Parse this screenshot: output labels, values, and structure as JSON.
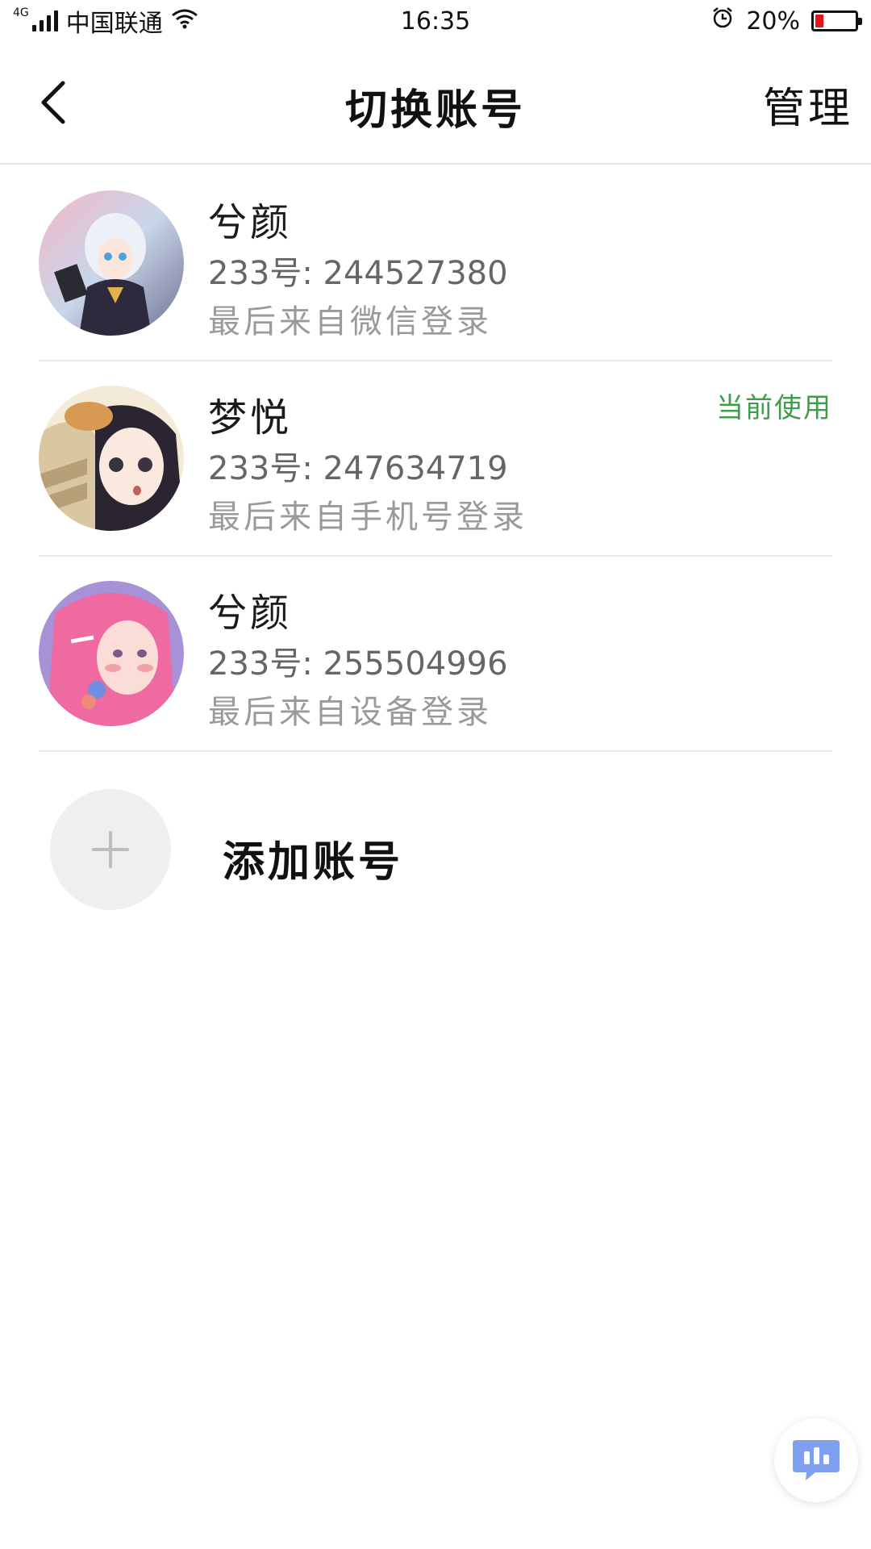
{
  "status_bar": {
    "network": "4G",
    "carrier": "中国联通",
    "time": "16:35",
    "battery": "20%",
    "battery_level": 0.2,
    "icons": [
      "signal-icon",
      "wifi-icon",
      "alarm-icon",
      "battery-icon"
    ]
  },
  "nav": {
    "title": "切换账号",
    "manage_label": "管理",
    "back_icon": "chevron-left-icon"
  },
  "accounts": [
    {
      "name": "兮颜",
      "id_text": "233号: 244527380",
      "login_text": "最后来自微信登录",
      "current_tag": ""
    },
    {
      "name": "梦悦",
      "id_text": "233号: 247634719",
      "login_text": "最后来自手机号登录",
      "current_tag": "当前使用"
    },
    {
      "name": "兮颜",
      "id_text": "233号: 255504996",
      "login_text": "最后来自设备登录",
      "current_tag": ""
    }
  ],
  "add_account": {
    "label": "添加账号",
    "icon": "plus-icon"
  },
  "colors": {
    "accent_green": "#3f9c4a",
    "divider": "#e9e9e9",
    "battery_low": "#e3151a",
    "float_icon": "#7fa0ee"
  }
}
